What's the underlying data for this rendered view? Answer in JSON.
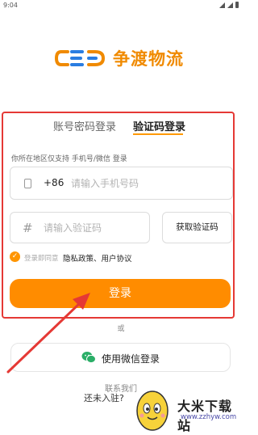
{
  "status_bar": {
    "time": "9:04"
  },
  "logo": {
    "text": "争渡物流",
    "brand_color": "#f08a00",
    "mark_color": "#2a7de1"
  },
  "tabs": [
    {
      "label": "账号密码登录",
      "active": false
    },
    {
      "label": "验证码登录",
      "active": true
    }
  ],
  "form": {
    "region_hint": "你所在地区仅支持 手机号/微信 登录",
    "country_code": "+86",
    "phone_placeholder": "请输入手机号码",
    "phone_value": "",
    "code_placeholder": "请输入验证码",
    "code_value": "",
    "get_code_label": "获取验证码",
    "agreement_prefix": "登录即同意",
    "agreement_links": "隐私政策、用户协议",
    "agreement_checked": true,
    "login_label": "登录"
  },
  "alt_login": {
    "or_label": "或",
    "wechat_label": "使用微信登录"
  },
  "footer": {
    "contact_label": "联系我们",
    "not_joined_label": "还未入驻?"
  },
  "watermark": {
    "title": "大米下载站",
    "url": "www.zzhyw.com"
  },
  "colors": {
    "accent": "#ff8c00",
    "annotation": "#e53935",
    "wechat_green": "#2aae67"
  },
  "icons": {
    "phone": "phone-icon",
    "code": "hash-icon",
    "wechat": "wechat-icon",
    "check": "check-icon"
  }
}
